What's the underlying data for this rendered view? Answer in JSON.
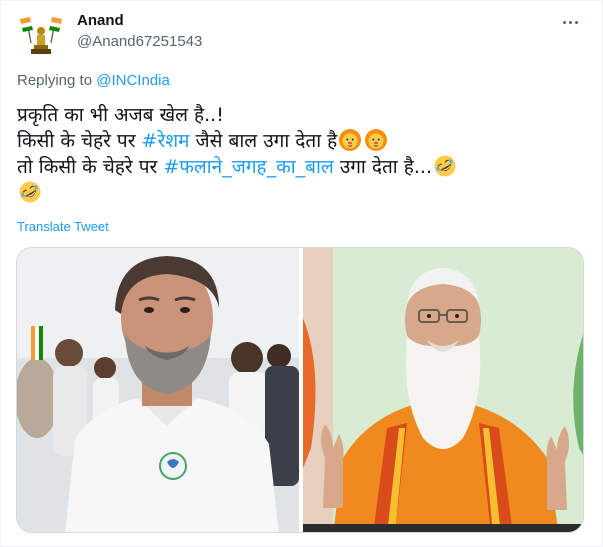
{
  "author": {
    "display_name": "Anand",
    "handle": "@Anand67251543",
    "avatar_icon": "emblem-icon"
  },
  "menu": {
    "icon": "more-icon"
  },
  "reply": {
    "prefix": "Replying to ",
    "mention": "@INCIndia"
  },
  "tweet": {
    "line1": "प्रकृति का भी अजब खेल है..!",
    "line2_pre": " किसी के चेहरे पर ",
    "line2_tag": "#रेशम",
    "line2_post": " जैसे बाल उगा देता है",
    "line3_pre": " तो किसी के चेहरे पर ",
    "line3_tag": "#फलाने_जगह_का_बाल",
    "line3_post": " उगा देता है...",
    "emojis": [
      "lion-face-icon",
      "lion-face-icon",
      "rolling-laughing-icon",
      "rolling-laughing-icon"
    ]
  },
  "translate_label": "Translate Tweet",
  "media": {
    "colors": {
      "accent": "#1d9bf0",
      "secondary_text": "#536471",
      "border": "#cfd9de"
    }
  }
}
